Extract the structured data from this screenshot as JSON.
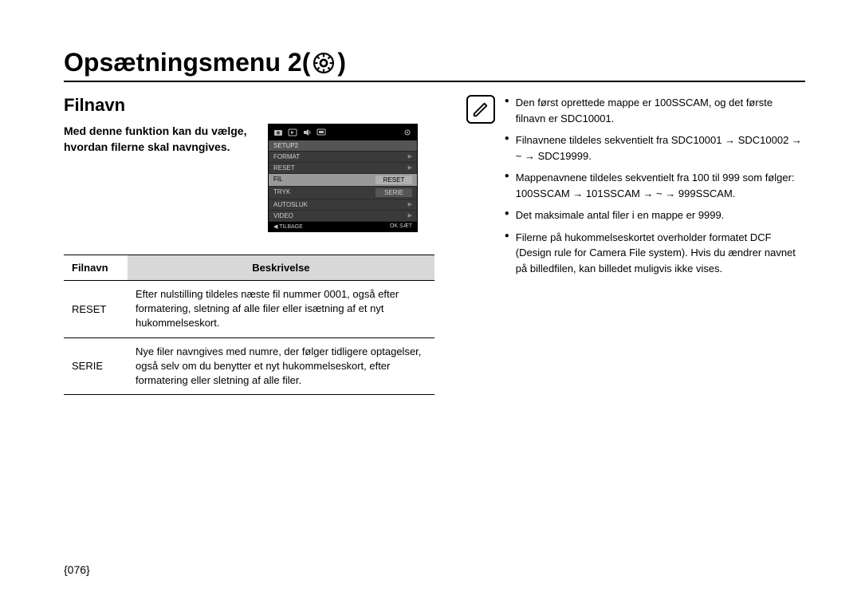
{
  "page": {
    "title_prefix": "Opsætningsmenu 2(",
    "title_suffix": ")",
    "section": "Filnavn",
    "intro": "Med denne funktion kan du vælge, hvordan filerne skal navngives.",
    "number": "{076}"
  },
  "lcd": {
    "tab": "SETUP2",
    "items": [
      "FORMAT",
      "RESET",
      "FIL",
      "TRYK",
      "AUTOSLUK",
      "VIDEO"
    ],
    "sub_reset": "RESET",
    "sub_serie": "SERIE",
    "back": "TILBAGE",
    "ok": "OK",
    "set": "SÆT"
  },
  "table": {
    "head_col1": "Filnavn",
    "head_col2": "Beskrivelse",
    "rows": [
      {
        "label": "RESET",
        "desc": "Efter nulstilling tildeles næste fil nummer 0001, også efter formatering, sletning af alle filer eller isætning af et nyt hukommelseskort."
      },
      {
        "label": "SERIE",
        "desc": "Nye filer navngives med numre, der følger tidligere optagelser, også selv om du benytter et nyt hukommelseskort, efter formatering eller sletning af alle filer."
      }
    ]
  },
  "notes": [
    "Den først oprettede mappe er 100SSCAM, og det første filnavn er SDC10001.",
    "Filnavnene tildeles sekventielt fra SDC10001 → SDC10002 → ~ → SDC19999.",
    "Mappenavnene tildeles sekventielt fra 100 til 999 som følger: 100SSCAM → 101SSCAM → ~ → 999SSCAM.",
    "Det maksimale antal filer i en mappe er 9999.",
    "Filerne på hukommelseskortet overholder formatet DCF (Design rule for Camera File system). Hvis du ændrer navnet på billedfilen, kan billedet muligvis ikke vises."
  ]
}
